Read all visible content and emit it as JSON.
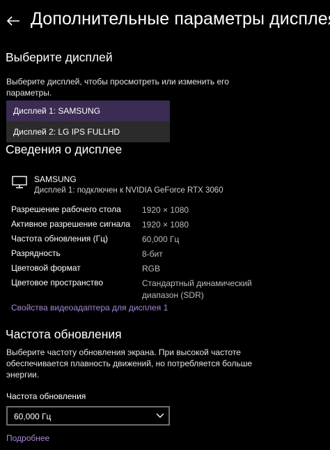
{
  "header": {
    "title": "Дополнительные параметры дисплея"
  },
  "select_display": {
    "heading": "Выберите дисплей",
    "description_line1": "Выберите дисплей, чтобы просмотреть или изменить его",
    "description_line2": "параметры.",
    "options": [
      "Дисплей 1: SAMSUNG",
      "Дисплей 2: LG IPS FULLHD"
    ],
    "selected_index": 0
  },
  "display_info": {
    "heading": "Сведения о дисплее",
    "name": "SAMSUNG",
    "subtitle": "Дисплей 1: подключен к NVIDIA GeForce RTX 3060",
    "rows": [
      {
        "label": "Разрешение рабочего стола",
        "value": "1920 × 1080"
      },
      {
        "label": "Активное разрешение сигнала",
        "value": "1920 × 1080"
      },
      {
        "label": "Частота обновления (Гц)",
        "value": "60,000 Гц"
      },
      {
        "label": "Разрядность",
        "value": "8-бит"
      },
      {
        "label": "Цветовой формат",
        "value": "RGB"
      },
      {
        "label": "Цветовое пространство",
        "value": "Стандартный динамический диапазон (SDR)"
      }
    ],
    "adapter_link": "Свойства видеоадаптера для дисплея 1"
  },
  "refresh_rate": {
    "heading": "Частота обновления",
    "description_line1": "Выберите частоту обновления экрана. При высокой частоте",
    "description_line2": "обеспечивается плавность движений, но потребляется больше",
    "description_line3": "энергии.",
    "field_label": "Частота обновления",
    "selected_value": "60,000 Гц",
    "more_link": "Подробнее"
  },
  "colors": {
    "background": "#000000",
    "accent_link": "#a68ad6",
    "selected_item": "#3a2c52"
  }
}
